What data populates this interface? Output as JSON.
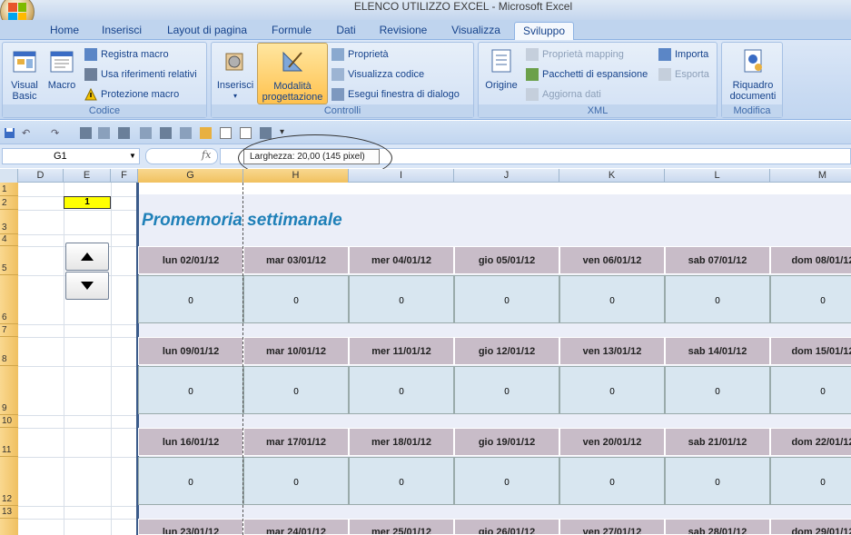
{
  "window": {
    "title": "ELENCO UTILIZZO EXCEL - Microsoft Excel"
  },
  "tabs": [
    {
      "label": "Home"
    },
    {
      "label": "Inserisci"
    },
    {
      "label": "Layout di pagina"
    },
    {
      "label": "Formule"
    },
    {
      "label": "Dati"
    },
    {
      "label": "Revisione"
    },
    {
      "label": "Visualizza"
    },
    {
      "label": "Sviluppo"
    }
  ],
  "active_tab": "Sviluppo",
  "ribbon": {
    "codice": {
      "label": "Codice",
      "visual_basic": "Visual Basic",
      "macro": "Macro",
      "registra": "Registra macro",
      "riferimenti": "Usa riferimenti relativi",
      "protezione": "Protezione macro"
    },
    "controlli": {
      "label": "Controlli",
      "inserisci": "Inserisci",
      "modalita": "Modalità progettazione",
      "proprieta": "Proprietà",
      "visualizza_codice": "Visualizza codice",
      "esegui": "Esegui finestra di dialogo"
    },
    "xml": {
      "label": "XML",
      "origine": "Origine",
      "proprieta_mapping": "Proprietà mapping",
      "pacchetti": "Pacchetti di espansione",
      "aggiorna": "Aggiorna dati",
      "importa": "Importa",
      "esporta": "Esporta"
    },
    "modifica": {
      "label": "Modifica",
      "riquadro": "Riquadro documenti"
    }
  },
  "formula_bar": {
    "name_box": "G1",
    "fx": "fx",
    "value": ""
  },
  "tooltip": "Larghezza: 20,00 (145 pixel)",
  "columns": [
    "D",
    "E",
    "F",
    "G",
    "H",
    "I",
    "J",
    "K",
    "L",
    "M"
  ],
  "rows": [
    "1",
    "2",
    "3",
    "4",
    "5",
    "6",
    "7",
    "8",
    "9",
    "10",
    "11",
    "12",
    "13"
  ],
  "cell_e2": "1",
  "calendar": {
    "title": "Promemoria settimanale",
    "weeks": [
      {
        "days": [
          "lun 02/01/12",
          "mar 03/01/12",
          "mer 04/01/12",
          "gio 05/01/12",
          "ven 06/01/12",
          "sab 07/01/12",
          "dom 08/01/12"
        ],
        "values": [
          "0",
          "0",
          "0",
          "0",
          "0",
          "0",
          "0"
        ]
      },
      {
        "days": [
          "lun 09/01/12",
          "mar 10/01/12",
          "mer 11/01/12",
          "gio 12/01/12",
          "ven 13/01/12",
          "sab 14/01/12",
          "dom 15/01/12"
        ],
        "values": [
          "0",
          "0",
          "0",
          "0",
          "0",
          "0",
          "0"
        ]
      },
      {
        "days": [
          "lun 16/01/12",
          "mar 17/01/12",
          "mer 18/01/12",
          "gio 19/01/12",
          "ven 20/01/12",
          "sab 21/01/12",
          "dom 22/01/12"
        ],
        "values": [
          "0",
          "0",
          "0",
          "0",
          "0",
          "0",
          "0"
        ]
      },
      {
        "days": [
          "lun 23/01/12",
          "mar 24/01/12",
          "mer 25/01/12",
          "gio 26/01/12",
          "ven 27/01/12",
          "sab 28/01/12",
          "dom 29/01/12"
        ],
        "values": []
      }
    ]
  }
}
